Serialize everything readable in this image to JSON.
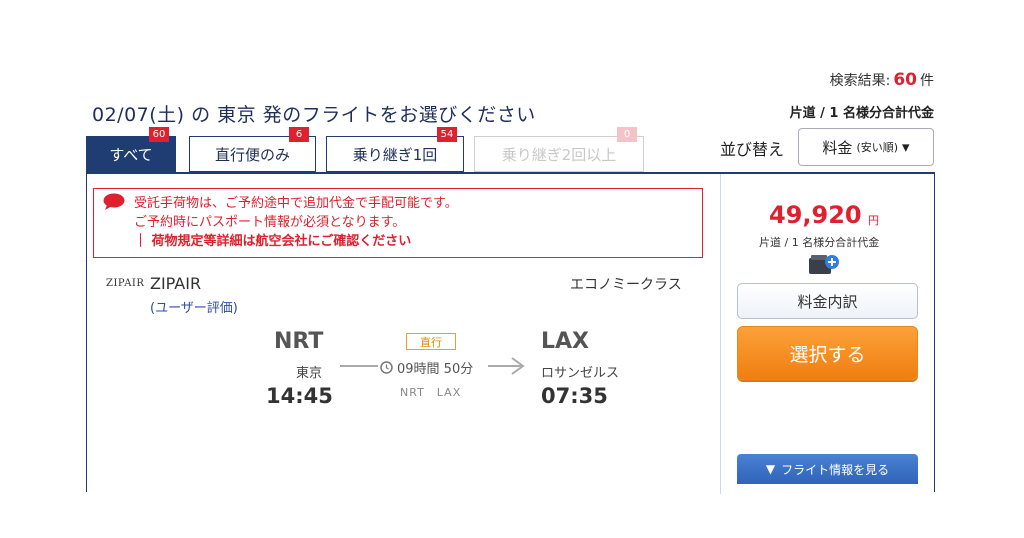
{
  "header": {
    "title": "02/07(土) の 東京 発のフライトをお選びください",
    "result_label": "検索結果:",
    "result_count": "60",
    "result_unit": "件",
    "price_caption": "片道 / 1 名様分合計代金"
  },
  "tabs": [
    {
      "label": "すべて",
      "count": "60",
      "state": "active"
    },
    {
      "label": "直行便のみ",
      "count": "6",
      "state": "normal"
    },
    {
      "label": "乗り継ぎ1回",
      "count": "54",
      "state": "normal"
    },
    {
      "label": "乗り継ぎ2回以上",
      "count": "0",
      "state": "disabled"
    }
  ],
  "sort": {
    "label": "並び替え",
    "selected": "料金",
    "selected_sub": "(安い順)",
    "arrow": "▾"
  },
  "notice": {
    "line1": "受託手荷物は、ご予約途中で追加代金で手配可能です。",
    "line2": "ご予約時にパスポート情報が必須となります。",
    "line3": "｜ 荷物規定等詳細は航空会社にご確認ください",
    "icon": "speech-bubble-icon"
  },
  "flight": {
    "airline_logo": "ZIPAIR",
    "airline_name": "ZIPAIR",
    "user_rating": "(ユーザー評価)",
    "cabin_class": "エコノミークラス",
    "departure": {
      "code": "NRT",
      "city": "東京",
      "time": "14:45"
    },
    "arrival": {
      "code": "LAX",
      "city": "ロサンゼルス",
      "time": "07:35"
    },
    "nonstop_label": "直行",
    "duration": "09時間 50分",
    "route_codes": "NRT　LAX"
  },
  "price_panel": {
    "amount": "49,920",
    "unit": "円",
    "caption": "片道 / 1 名様分合計代金",
    "fare_breakdown_label": "料金内訳",
    "select_label": "選択する",
    "flight_info_label": "フライト情報を見る",
    "flight_info_arrow": "▼"
  },
  "colors": {
    "brand_navy": "#1f3c73",
    "accent_red": "#e0202e",
    "select_orange": "#f28a1e",
    "info_blue": "#3a6fc4"
  }
}
